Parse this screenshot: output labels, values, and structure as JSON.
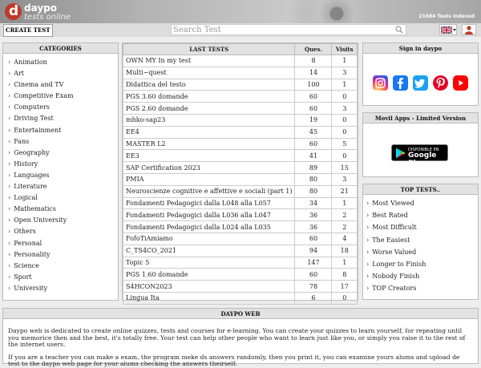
{
  "header": {
    "logo_letter": "d",
    "logo_name": "daypo",
    "logo_tagline": "tests online",
    "tests_count": "21684 Tests Indexed"
  },
  "toolbar": {
    "create_test_label": "CREATE TEST",
    "search_placeholder": "Search Test"
  },
  "categories": {
    "title": "CATEGORIES",
    "items": [
      "Animation",
      "Art",
      "Cinema and TV",
      "Competitive Exam",
      "Computers",
      "Driving Test",
      "Entertainment",
      "Fans",
      "Geography",
      "History",
      "Languages",
      "Literature",
      "Logical",
      "Mathematics",
      "Open University",
      "Others",
      "Personal",
      "Personality",
      "Science",
      "Sport",
      "University"
    ]
  },
  "last_tests": {
    "title": "LAST TESTS",
    "col_ques": "Ques.",
    "col_visits": "Visits",
    "rows": [
      {
        "name": "OWN MY   In my test",
        "ques": "8",
        "visits": "1"
      },
      {
        "name": "Multi~quest",
        "ques": "14",
        "visits": "3"
      },
      {
        "name": "Didattica del testo",
        "ques": "100",
        "visits": "1"
      },
      {
        "name": "PGS 3.60 domande",
        "ques": "60",
        "visits": "0"
      },
      {
        "name": "PGS 2.60 domande",
        "ques": "60",
        "visits": "3"
      },
      {
        "name": "mhko-sap23",
        "ques": "19",
        "visits": "0"
      },
      {
        "name": "EE4",
        "ques": "45",
        "visits": "0"
      },
      {
        "name": "MASTER L2",
        "ques": "60",
        "visits": "5"
      },
      {
        "name": "EE3",
        "ques": "41",
        "visits": "0"
      },
      {
        "name": "SAP Certification 2023",
        "ques": "89",
        "visits": "15"
      },
      {
        "name": "PMIA",
        "ques": "80",
        "visits": "3"
      },
      {
        "name": "Neuroscienze cognitive e affettive e sociali (part 1)",
        "ques": "80",
        "visits": "21"
      },
      {
        "name": "Fondamenti Pedagogici dalla L048 alla L057",
        "ques": "34",
        "visits": "1"
      },
      {
        "name": "Fondamenti Pedagogici dalla L036 alla L047",
        "ques": "36",
        "visits": "2"
      },
      {
        "name": "Fondamenti Pedagogici dalla L024 alla L035",
        "ques": "36",
        "visits": "2"
      },
      {
        "name": "FofoTiAmiamo",
        "ques": "60",
        "visits": "4"
      },
      {
        "name": "C_TS4CO_2021",
        "ques": "94",
        "visits": "18"
      },
      {
        "name": "Topic 5",
        "ques": "147",
        "visits": "1"
      },
      {
        "name": "PGS 1.60 domande",
        "ques": "60",
        "visits": "8"
      },
      {
        "name": "S4HCON2023",
        "ques": "78",
        "visits": "17"
      },
      {
        "name": "Lingua Ita",
        "ques": "6",
        "visits": "0"
      }
    ]
  },
  "signin": {
    "title": "Sign in daypo",
    "social": [
      {
        "icon": "instagram-icon",
        "color": "#d6249f"
      },
      {
        "icon": "facebook-icon",
        "color": "#1877f2"
      },
      {
        "icon": "twitter-icon",
        "color": "#1da1f2"
      },
      {
        "icon": "pinterest-icon",
        "color": "#e60023"
      },
      {
        "icon": "youtube-icon",
        "color": "#ff0000"
      }
    ]
  },
  "apps": {
    "title": "Movil Apps - Limited Version",
    "badge_top": "DISPONIBLE EN",
    "badge_main": "Google Play"
  },
  "top_tests": {
    "title": "TOP TESTS..",
    "items": [
      "Most Viewed",
      "Best Rated",
      "Most Difficult",
      "The Easiest",
      "Worse Valued",
      "Longer to Finish",
      "Nobody Finish",
      "TOP Creators"
    ]
  },
  "daypo_web": {
    "title": "DAYPO WEB",
    "p1": "Daypo web is dedicated to create online quizzes, tests and courses for e-learning. You can create your quizzes to learn yourself, for repeating until you memorice then and the best, it's totally free. Your test can help other people who want to learn just like you, or simply you raise it to the rest of the internet users.",
    "p2": "If you are a teacher you can make a exam, the program meke ds answers randomly, then you print it, you can examine yours alums and upload de test to the daypo web page for your alums checking the answers theirself."
  }
}
